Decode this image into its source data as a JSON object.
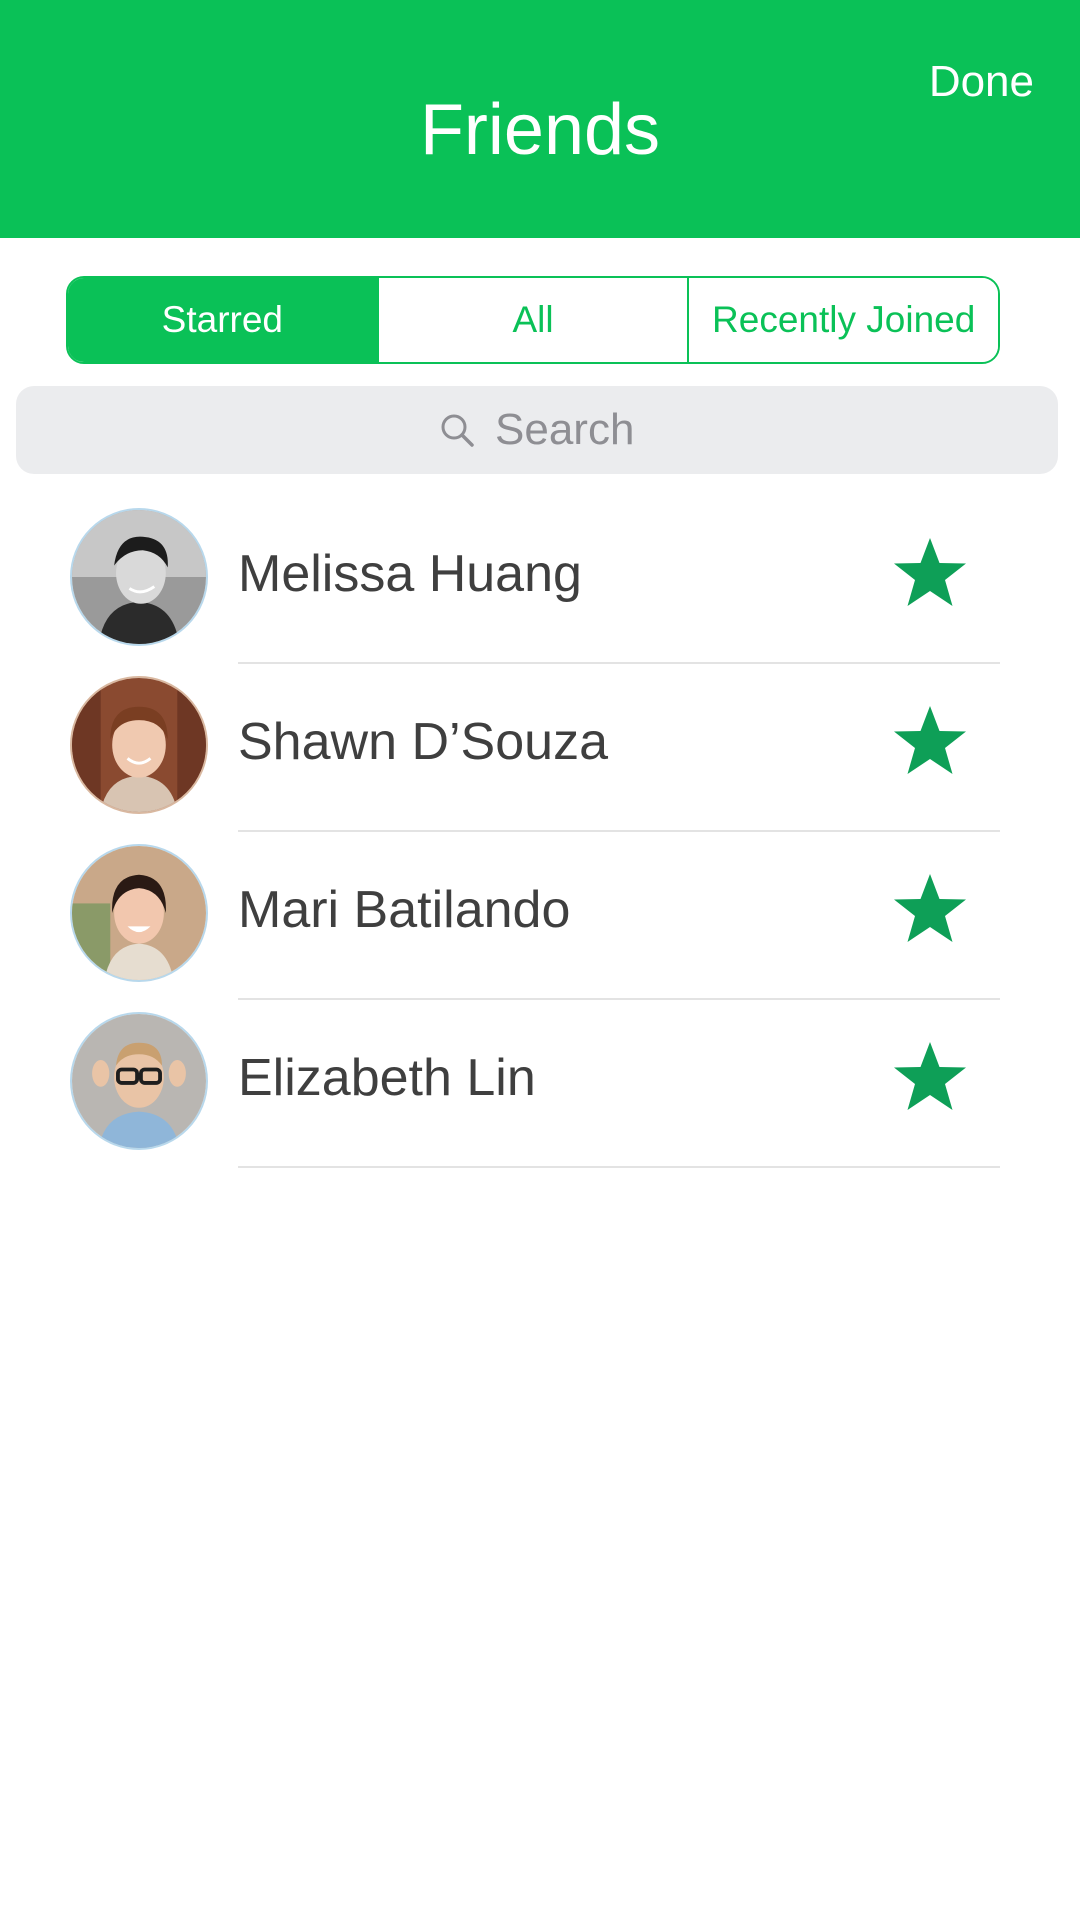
{
  "header": {
    "title": "Friends",
    "done_label": "Done"
  },
  "tabs": [
    {
      "label": "Starred",
      "selected": true
    },
    {
      "label": "All",
      "selected": false
    },
    {
      "label": "Recently Joined",
      "selected": false
    }
  ],
  "search": {
    "placeholder": "Search",
    "icon": "search-icon"
  },
  "friends": [
    {
      "name": "Melissa Huang",
      "starred": true,
      "avatar": "avatar-melissa"
    },
    {
      "name": "Shawn D’Souza",
      "starred": true,
      "avatar": "avatar-shawn"
    },
    {
      "name": "Mari Batilando",
      "starred": true,
      "avatar": "avatar-mari"
    },
    {
      "name": "Elizabeth Lin",
      "starred": true,
      "avatar": "avatar-elizabeth"
    }
  ],
  "colors": {
    "brand_green": "#0ac157",
    "star_green": "#0e9f57",
    "text_dark": "#3f3f3f",
    "search_bg": "#ebecee",
    "placeholder_gray": "#8e8e93"
  }
}
